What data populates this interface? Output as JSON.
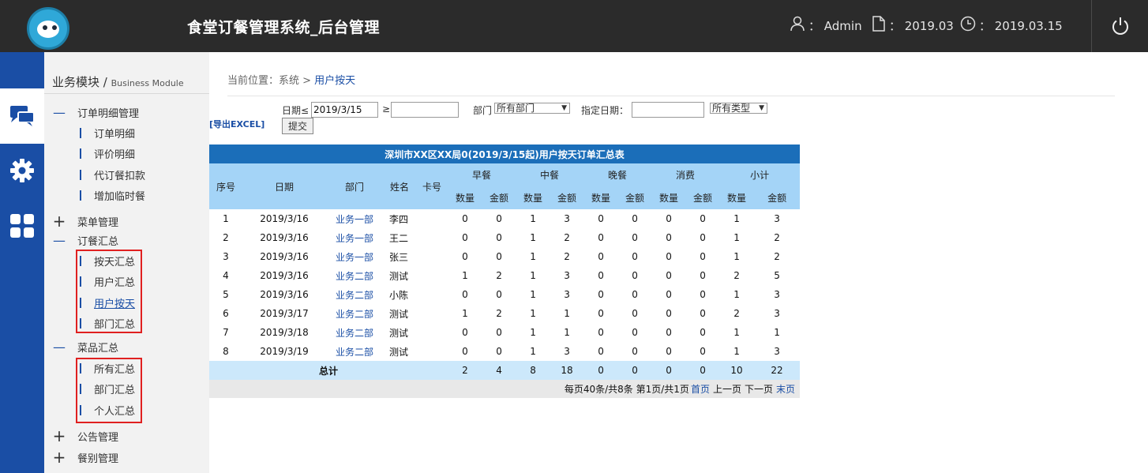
{
  "header": {
    "title": "食堂订餐管理系统_后台管理",
    "user": "： Admin",
    "month": "： 2019.03",
    "date": "： 2019.03.15"
  },
  "sidebar": {
    "module_title": "业务模块",
    "module_sub": "Business Module",
    "groups": {
      "order_detail": "订单明细管理",
      "menu_mgmt": "菜单管理",
      "order_summary": "订餐汇总",
      "dish_summary": "菜品汇总",
      "notice_mgmt": "公告管理",
      "meal_type_mgmt": "餐别管理"
    },
    "items": {
      "order_detail": "订单明细",
      "review_detail": "评价明细",
      "proxy_deduct": "代订餐扣款",
      "add_temp_meal": "增加临时餐",
      "by_day": "按天汇总",
      "by_user": "用户汇总",
      "user_by_day": "用户按天",
      "by_dept": "部门汇总",
      "all_summary": "所有汇总",
      "dept_summary": "部门汇总",
      "personal_summary": "个人汇总"
    }
  },
  "breadcrumb": {
    "prefix": "当前位置：系统 >",
    "current": "用户按天"
  },
  "filters": {
    "date_le_label": "日期≤",
    "date_le_value": "2019/3/15",
    "date_ge_label": "≥",
    "date_ge_value": "",
    "dept_label": "部门",
    "dept_value": "所有部门",
    "specified_date_label": "指定日期：",
    "specified_date_value": "",
    "type_value": "所有类型",
    "submit": "提交",
    "export": "[导出EXCEL]"
  },
  "table": {
    "caption": "深圳市XX区XX局0(2019/3/15起)用户按天订单汇总表",
    "headers": {
      "seq": "序号",
      "date": "日期",
      "dept": "部门",
      "name": "姓名",
      "card": "卡号",
      "breakfast": "早餐",
      "lunch": "中餐",
      "dinner": "晚餐",
      "consume": "消费",
      "subtotal": "小计",
      "qty": "数量",
      "amount": "金额"
    },
    "rows": [
      [
        "1",
        "2019/3/16",
        "业务一部",
        "李四",
        "",
        "0",
        "0",
        "1",
        "3",
        "0",
        "0",
        "0",
        "0",
        "1",
        "3"
      ],
      [
        "2",
        "2019/3/16",
        "业务一部",
        "王二",
        "",
        "0",
        "0",
        "1",
        "2",
        "0",
        "0",
        "0",
        "0",
        "1",
        "2"
      ],
      [
        "3",
        "2019/3/16",
        "业务一部",
        "张三",
        "",
        "0",
        "0",
        "1",
        "2",
        "0",
        "0",
        "0",
        "0",
        "1",
        "2"
      ],
      [
        "4",
        "2019/3/16",
        "业务二部",
        "测试",
        "",
        "1",
        "2",
        "1",
        "3",
        "0",
        "0",
        "0",
        "0",
        "2",
        "5"
      ],
      [
        "5",
        "2019/3/16",
        "业务二部",
        "小陈",
        "",
        "0",
        "0",
        "1",
        "3",
        "0",
        "0",
        "0",
        "0",
        "1",
        "3"
      ],
      [
        "6",
        "2019/3/17",
        "业务二部",
        "测试",
        "",
        "1",
        "2",
        "1",
        "1",
        "0",
        "0",
        "0",
        "0",
        "2",
        "3"
      ],
      [
        "7",
        "2019/3/18",
        "业务二部",
        "测试",
        "",
        "0",
        "0",
        "1",
        "1",
        "0",
        "0",
        "0",
        "0",
        "1",
        "1"
      ],
      [
        "8",
        "2019/3/19",
        "业务二部",
        "测试",
        "",
        "0",
        "0",
        "1",
        "3",
        "0",
        "0",
        "0",
        "0",
        "1",
        "3"
      ]
    ],
    "total_label": "总计",
    "totals": [
      "2",
      "4",
      "8",
      "18",
      "0",
      "0",
      "0",
      "0",
      "10",
      "22"
    ]
  },
  "pager": {
    "info": "每页40条/共8条 第1页/共1页",
    "first": "首页",
    "prev": "上一页",
    "next": "下一页",
    "last": "末页"
  }
}
